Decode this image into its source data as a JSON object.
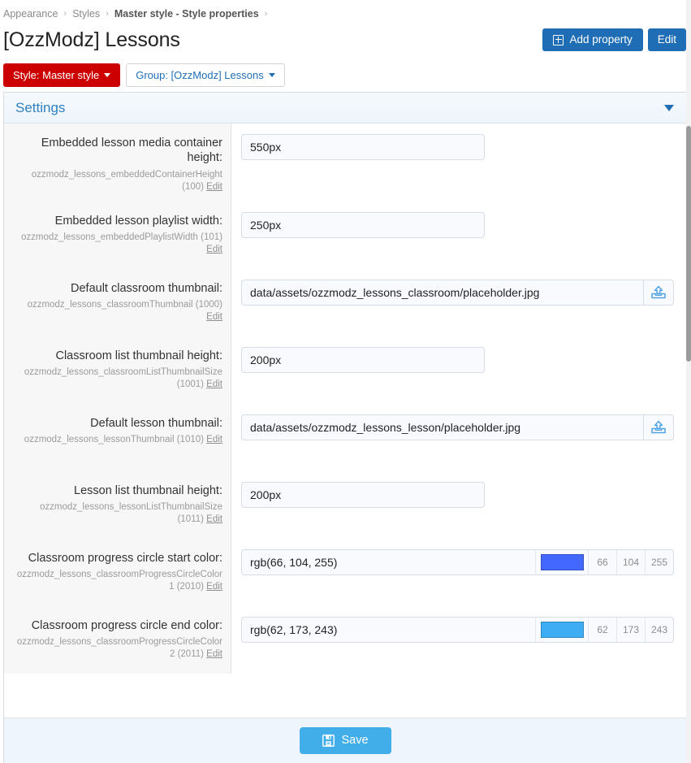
{
  "breadcrumb": {
    "items": [
      {
        "label": "Appearance",
        "strong": false
      },
      {
        "label": "Styles",
        "strong": false
      },
      {
        "label": "Master style - Style properties",
        "strong": true
      }
    ],
    "separator": "›"
  },
  "header": {
    "title": "[OzzModz] Lessons",
    "add_property_label": "Add property",
    "add_property_icon": "plus-square-icon",
    "edit_label": "Edit",
    "primary_color": "#1f6eb5"
  },
  "filters": {
    "style_pill": {
      "label": "Style: Master style",
      "color": "#cc0000"
    },
    "group_pill": {
      "label": "Group: [OzzModz] Lessons",
      "color": "#1f6eb5"
    }
  },
  "panel": {
    "title": "Settings",
    "collapse_icon": "chevron-down-icon",
    "title_color": "#2e7fc0"
  },
  "properties": [
    {
      "label": "Embedded lesson media container height:",
      "key": "ozzmodz_lessons_embeddedContainerHeight",
      "id": "(100)",
      "edit_label": "Edit",
      "control": "text-narrow",
      "value": "550px"
    },
    {
      "label": "Embedded lesson playlist width:",
      "key": "ozzmodz_lessons_embeddedPlaylistWidth",
      "id": "(101)",
      "edit_label": "Edit",
      "control": "text-narrow",
      "value": "250px"
    },
    {
      "label": "Default classroom thumbnail:",
      "key": "ozzmodz_lessons_classroomThumbnail",
      "id": "(1000)",
      "edit_label": "Edit",
      "control": "text-upload",
      "value": "data/assets/ozzmodz_lessons_classroom/placeholder.jpg",
      "upload_icon": "upload-icon"
    },
    {
      "label": "Classroom list thumbnail height:",
      "key": "ozzmodz_lessons_classroomListThumbnailSize",
      "id": "(1001)",
      "edit_label": "Edit",
      "control": "text-narrow",
      "value": "200px"
    },
    {
      "label": "Default lesson thumbnail:",
      "key": "ozzmodz_lessons_lessonThumbnail",
      "id": "(1010)",
      "edit_label": "Edit",
      "control": "text-upload",
      "value": "data/assets/ozzmodz_lessons_lesson/placeholder.jpg",
      "upload_icon": "upload-icon"
    },
    {
      "label": "Lesson list thumbnail height:",
      "key": "ozzmodz_lessons_lessonListThumbnailSize",
      "id": "(1011)",
      "edit_label": "Edit",
      "control": "text-narrow",
      "value": "200px"
    },
    {
      "label": "Classroom progress circle start color:",
      "key": "ozzmodz_lessons_classroomProgressCircleColor 1",
      "id": "(2010)",
      "edit_label": "Edit",
      "control": "color",
      "value": "rgb(66, 104, 255)",
      "swatch": "#4268ff",
      "channels": [
        "66",
        "104",
        "255"
      ]
    },
    {
      "label": "Classroom progress circle end color:",
      "key": "ozzmodz_lessons_classroomProgressCircleColor 2",
      "id": "(2011)",
      "edit_label": "Edit",
      "control": "color",
      "value": "rgb(62, 173, 243)",
      "swatch": "#3eadf3",
      "channels": [
        "62",
        "173",
        "243"
      ]
    }
  ],
  "footer": {
    "save_label": "Save",
    "save_icon": "floppy-disk-icon",
    "save_color": "#41aeea"
  }
}
